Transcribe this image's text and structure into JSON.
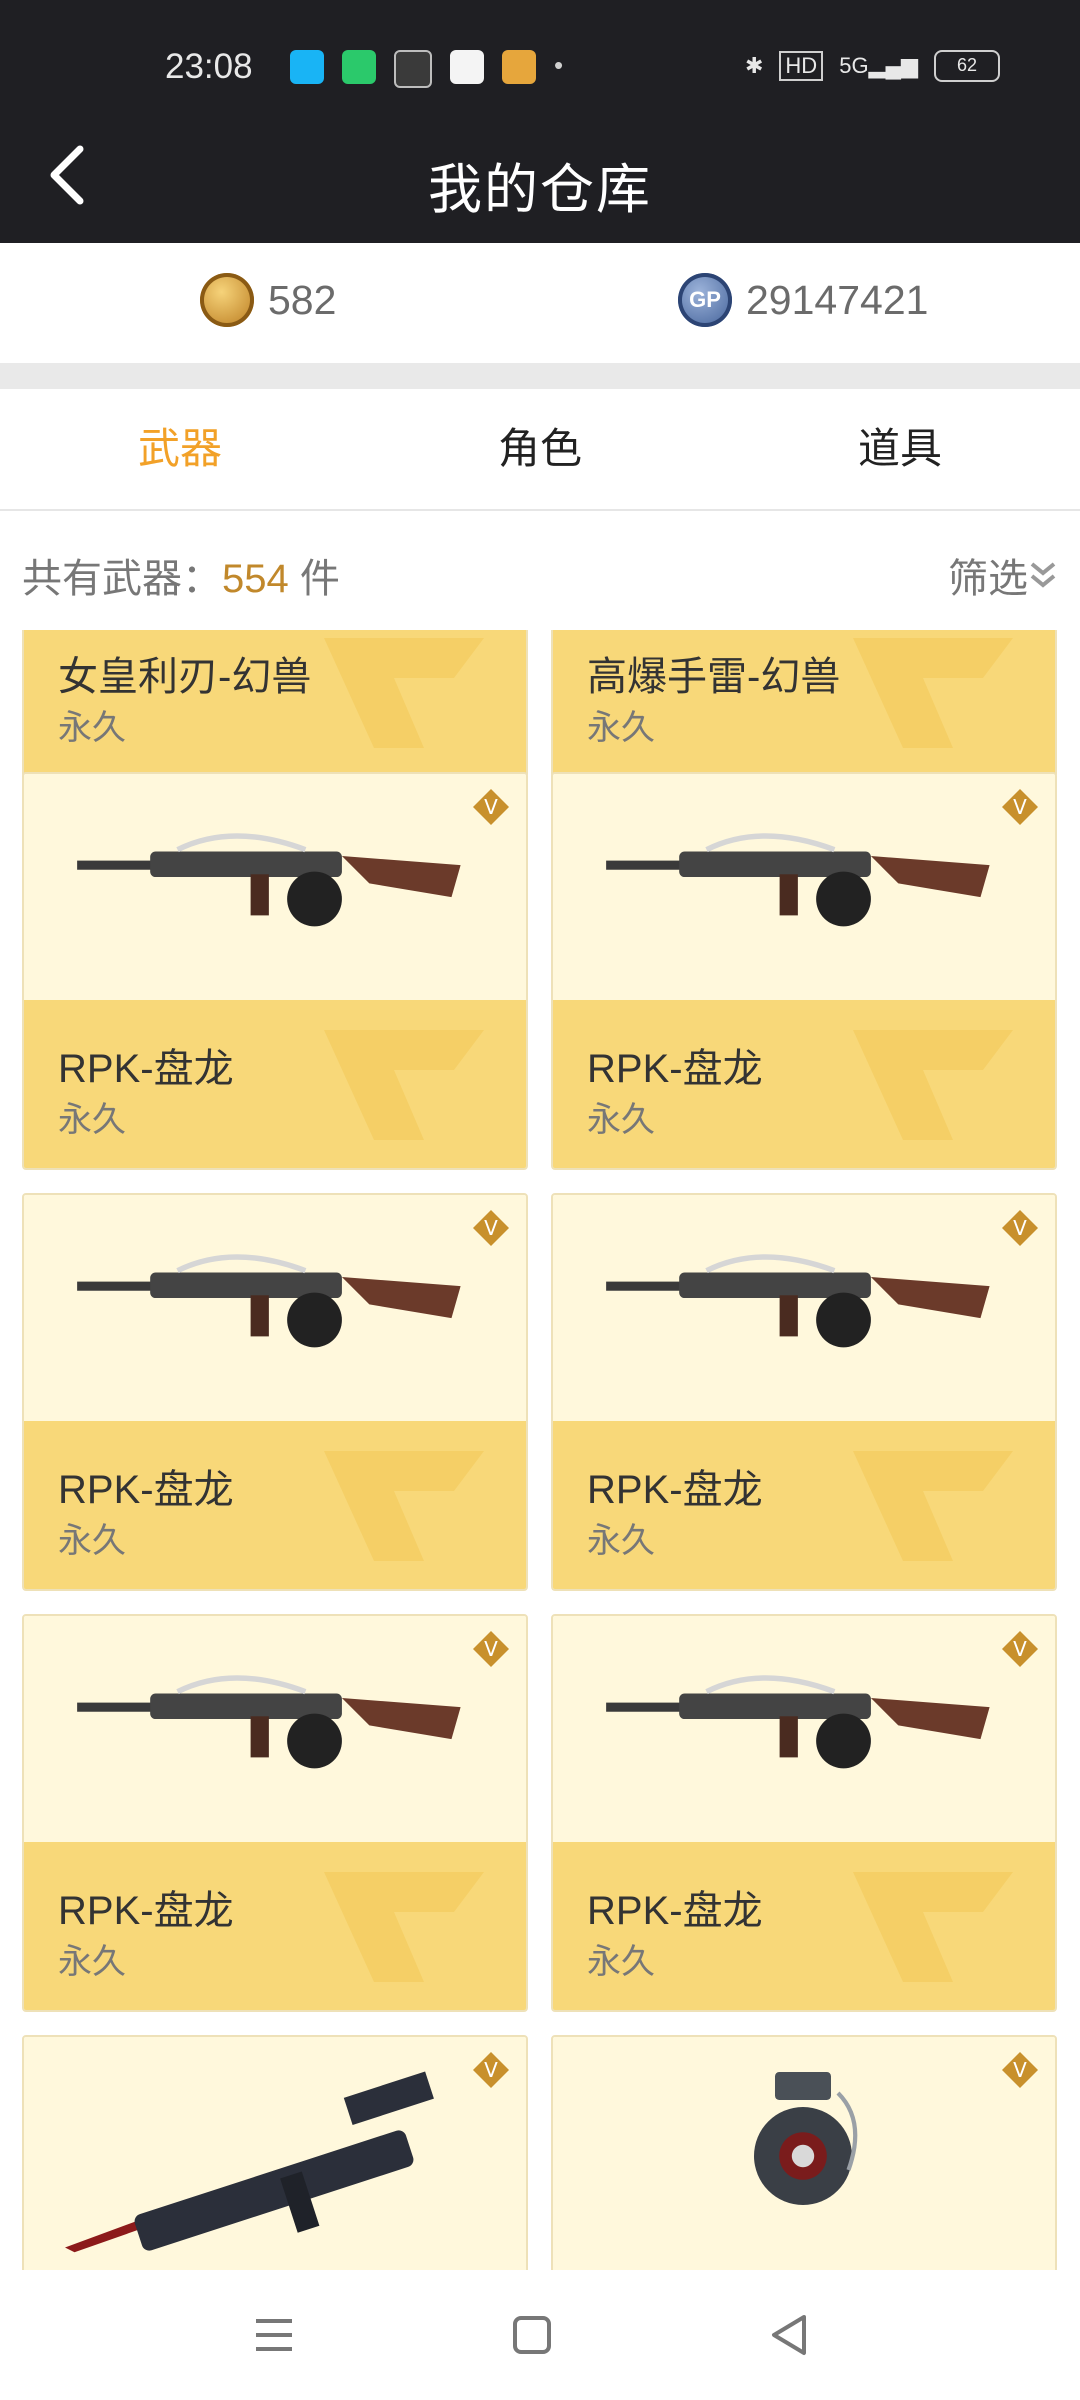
{
  "status_bar": {
    "time": "23:08",
    "network": "5G",
    "hd": "HD",
    "battery": "62"
  },
  "header": {
    "title": "我的仓库"
  },
  "currency": {
    "cf_value": "582",
    "gp_label": "GP",
    "gp_value": "29147421"
  },
  "tabs": [
    {
      "label": "武器",
      "active": true
    },
    {
      "label": "角色",
      "active": false
    },
    {
      "label": "道具",
      "active": false
    }
  ],
  "summary": {
    "label": "共有武器：",
    "count": "554",
    "unit": "件",
    "filter_label": "筛选"
  },
  "items": [
    {
      "name": "女皇利刃-幻兽",
      "duration": "永久"
    },
    {
      "name": "高爆手雷-幻兽",
      "duration": "永久"
    },
    {
      "name": "RPK-盘龙",
      "duration": "永久",
      "badge": "V",
      "image": "rpk-rifle"
    },
    {
      "name": "RPK-盘龙",
      "duration": "永久",
      "badge": "V",
      "image": "rpk-rifle"
    },
    {
      "name": "RPK-盘龙",
      "duration": "永久",
      "badge": "V",
      "image": "rpk-rifle"
    },
    {
      "name": "RPK-盘龙",
      "duration": "永久",
      "badge": "V",
      "image": "rpk-rifle"
    },
    {
      "name": "RPK-盘龙",
      "duration": "永久",
      "badge": "V",
      "image": "rpk-rifle"
    },
    {
      "name": "RPK-盘龙",
      "duration": "永久",
      "badge": "V",
      "image": "rpk-rifle"
    },
    {
      "badge": "V",
      "image": "rifle-with-blade"
    },
    {
      "badge": "V",
      "image": "grenade"
    }
  ],
  "colors": {
    "accent": "#f2a128",
    "header_bg": "#1f1f23",
    "card_top": "#fff8dc",
    "card_bottom": "#f8d879"
  }
}
